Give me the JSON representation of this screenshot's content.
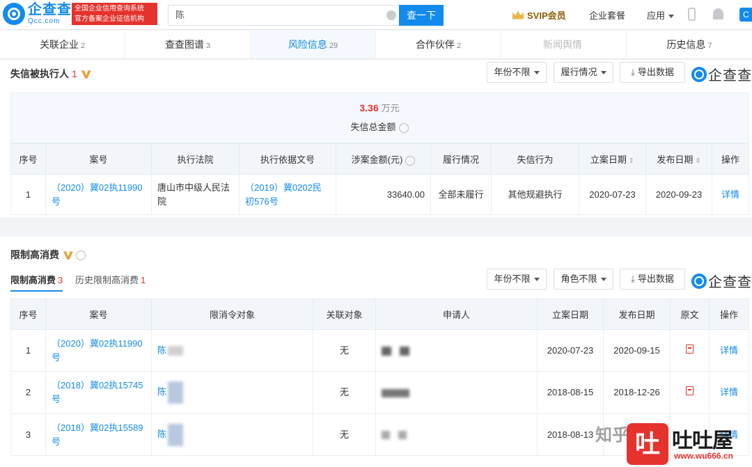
{
  "header": {
    "logo_cn": "企查查",
    "logo_en": "Qcc.com",
    "badge_line1": "全国企业信用查询系统",
    "badge_line2": "官方备案企业征信机构",
    "search_value": "陈",
    "search_button": "查一下",
    "svip": "SVIP会员",
    "nav_package": "企业套餐",
    "nav_app": "应用",
    "user_initial": "C"
  },
  "tabs": [
    {
      "label": "关联企业",
      "count": "2"
    },
    {
      "label": "查查图谱",
      "count": "3"
    },
    {
      "label": "风险信息",
      "count": "29"
    },
    {
      "label": "合作伙伴",
      "count": "2"
    },
    {
      "label": "新闻舆情",
      "count": ""
    },
    {
      "label": "历史信息",
      "count": "7"
    }
  ],
  "section1": {
    "title": "失信被执行人",
    "count": "1",
    "filter_year": "年份不限",
    "filter_perform": "履行情况",
    "export": "导出数据",
    "brand": "企查查",
    "total_amount": "3.36",
    "total_unit": "万元",
    "total_label": "失信总金额",
    "columns": [
      "序号",
      "案号",
      "执行法院",
      "执行依据文号",
      "涉案金额(元)",
      "履行情况",
      "失信行为",
      "立案日期",
      "发布日期",
      "操作"
    ],
    "rows": [
      {
        "no": "1",
        "case": "（2020）冀02执11990号",
        "court": "唐山市中级人民法院",
        "basis": "（2019）冀0202民初576号",
        "amount": "33640.00",
        "perform": "全部未履行",
        "behavior": "其他规避执行",
        "filed": "2020-07-23",
        "published": "2020-09-23",
        "action": "详情"
      }
    ]
  },
  "section2": {
    "title": "限制高消费",
    "subtab_current": "限制高消费",
    "subtab_current_count": "3",
    "subtab_history": "历史限制高消费",
    "subtab_history_count": "1",
    "filter_year": "年份不限",
    "filter_role": "角色不限",
    "export": "导出数据",
    "brand": "企查查",
    "columns": [
      "序号",
      "案号",
      "限消令对象",
      "关联对象",
      "申请人",
      "立案日期",
      "发布日期",
      "原文",
      "操作"
    ],
    "rows": [
      {
        "no": "1",
        "case": "（2020）冀02执11990号",
        "target": "陈",
        "related": "无",
        "filed": "2020-07-23",
        "published": "2020-09-15",
        "action": "详情"
      },
      {
        "no": "2",
        "case": "（2018）冀02执15745号",
        "target": "陈",
        "related": "无",
        "filed": "2018-08-15",
        "published": "2018-12-26",
        "action": "详情"
      },
      {
        "no": "3",
        "case": "（2018）冀02执15589号",
        "target": "陈",
        "related": "无",
        "filed": "2018-08-13",
        "published": "",
        "action": "详情"
      }
    ]
  },
  "watermark": {
    "zhihu": "知乎",
    "logo_char": "吐",
    "site_name": "吐吐屋",
    "site_url": "www.wu666.cn"
  }
}
